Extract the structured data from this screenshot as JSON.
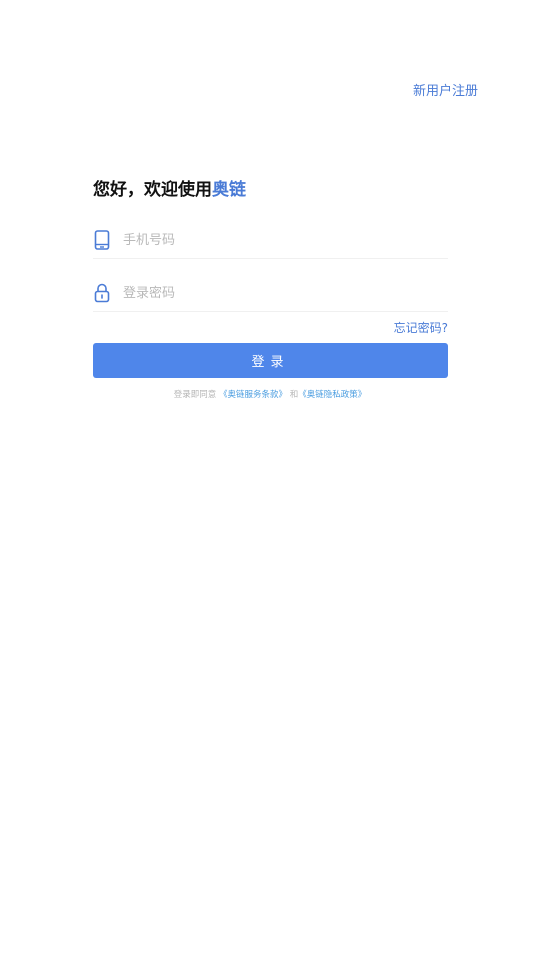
{
  "header": {
    "register_label": "新用户注册"
  },
  "welcome": {
    "prefix": "您好，欢迎使用",
    "brand": "奥链"
  },
  "form": {
    "phone_placeholder": "手机号码",
    "phone_icon": "phone-icon",
    "password_placeholder": "登录密码",
    "password_icon": "lock-icon",
    "forgot_label": "忘记密码?",
    "login_label": "登录"
  },
  "agreement": {
    "prefix": "登录即同意",
    "terms_link": "《奥链服务条款》",
    "connector": "和",
    "privacy_link": "《奥链隐私政策》"
  },
  "colors": {
    "accent": "#4a7bd6",
    "button": "#4f86ea",
    "link": "#4a9de0"
  }
}
